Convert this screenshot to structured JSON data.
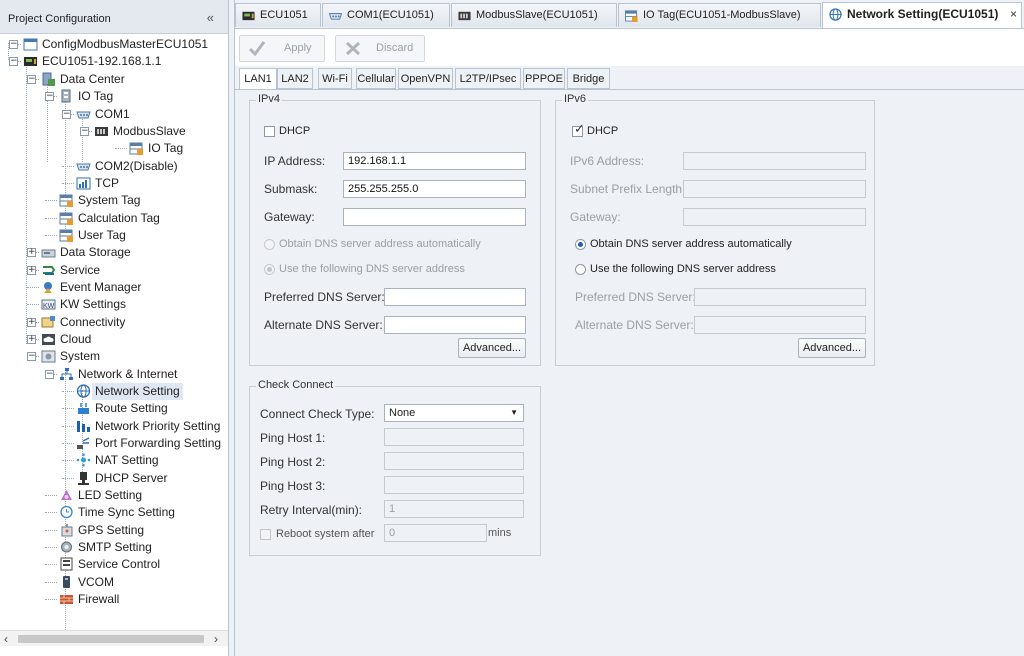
{
  "left_panel": {
    "title": "Project Configuration",
    "collapse_glyph": "«",
    "tree": [
      {
        "id": "config",
        "label": "ConfigModbusMasterECU1051",
        "icon": "window-icon",
        "exp": "−"
      },
      {
        "id": "ecu",
        "label": "ECU1051-192.168.1.1",
        "icon": "device-icon",
        "exp": "−"
      },
      {
        "id": "data-center",
        "label": "Data Center",
        "icon": "data-center-icon",
        "exp": "−"
      },
      {
        "id": "io-tag",
        "label": "IO Tag",
        "icon": "io-tag-icon",
        "exp": "−"
      },
      {
        "id": "com1",
        "label": "COM1",
        "icon": "com-port-icon",
        "exp": "−"
      },
      {
        "id": "modbus-slave",
        "label": "ModbusSlave",
        "icon": "modbus-slave-icon",
        "exp": "−"
      },
      {
        "id": "io-tag-sub",
        "label": "IO Tag",
        "icon": "tag-table-icon"
      },
      {
        "id": "com2",
        "label": "COM2(Disable)",
        "icon": "com-port-icon"
      },
      {
        "id": "tcp",
        "label": "TCP",
        "icon": "tcp-icon"
      },
      {
        "id": "system-tag",
        "label": "System Tag",
        "icon": "tag-table-icon"
      },
      {
        "id": "calculation-tag",
        "label": "Calculation Tag",
        "icon": "tag-table-icon"
      },
      {
        "id": "user-tag",
        "label": "User Tag",
        "icon": "tag-table-icon"
      },
      {
        "id": "data-storage",
        "label": "Data Storage",
        "icon": "storage-icon",
        "exp": "+"
      },
      {
        "id": "service",
        "label": "Service",
        "icon": "service-icon",
        "exp": "+"
      },
      {
        "id": "event-manager",
        "label": "Event Manager",
        "icon": "event-manager-icon"
      },
      {
        "id": "kw-settings",
        "label": "KW Settings",
        "icon": "kw-icon"
      },
      {
        "id": "connectivity",
        "label": "Connectivity",
        "icon": "connectivity-icon",
        "exp": "+"
      },
      {
        "id": "cloud",
        "label": "Cloud",
        "icon": "cloud-icon",
        "exp": "+"
      },
      {
        "id": "system",
        "label": "System",
        "icon": "system-icon",
        "exp": "−"
      },
      {
        "id": "network-internet",
        "label": "Network & Internet",
        "icon": "network-icon",
        "exp": "−"
      },
      {
        "id": "network-setting",
        "label": "Network Setting",
        "icon": "globe-icon"
      },
      {
        "id": "route-setting",
        "label": "Route Setting",
        "icon": "route-icon"
      },
      {
        "id": "network-priority",
        "label": "Network Priority Setting",
        "icon": "priority-icon"
      },
      {
        "id": "port-forwarding",
        "label": "Port Forwarding Setting",
        "icon": "port-forwarding-icon"
      },
      {
        "id": "nat-setting",
        "label": "NAT Setting",
        "icon": "nat-icon"
      },
      {
        "id": "dhcp-server",
        "label": "DHCP Server",
        "icon": "dhcp-server-icon"
      },
      {
        "id": "led-setting",
        "label": "LED Setting",
        "icon": "led-icon"
      },
      {
        "id": "time-sync",
        "label": "Time Sync Setting",
        "icon": "clock-icon"
      },
      {
        "id": "gps-setting",
        "label": "GPS Setting",
        "icon": "gps-icon"
      },
      {
        "id": "smtp-setting",
        "label": "SMTP Setting",
        "icon": "smtp-icon"
      },
      {
        "id": "service-control",
        "label": "Service Control",
        "icon": "service-control-icon"
      },
      {
        "id": "vcom",
        "label": "VCOM",
        "icon": "vcom-icon"
      },
      {
        "id": "firewall",
        "label": "Firewall",
        "icon": "firewall-icon"
      }
    ],
    "scroll_left": "‹",
    "scroll_right": "›"
  },
  "doc_tabs": [
    {
      "label": "ECU1051",
      "icon": "device-icon"
    },
    {
      "label": "COM1(ECU1051)",
      "icon": "com-port-icon"
    },
    {
      "label": "ModbusSlave(ECU1051)",
      "icon": "modbus-slave-icon"
    },
    {
      "label": "IO Tag(ECU1051-ModbusSlave)",
      "icon": "tag-table-icon"
    },
    {
      "label": "Network Setting(ECU1051)",
      "icon": "globe-icon",
      "active": true
    }
  ],
  "close_glyph": "×",
  "toolbar": {
    "apply_label": "Apply",
    "discard_label": "Discard"
  },
  "sub_tabs": [
    "LAN1",
    "LAN2",
    "Wi-Fi",
    "Cellular",
    "OpenVPN",
    "L2TP/IPsec",
    "PPPOE",
    "Bridge"
  ],
  "ipv4": {
    "title": "IPv4",
    "dhcp_label": "DHCP",
    "dhcp_checked": false,
    "ip_label": "IP Address:",
    "ip_value": "192.168.1.1",
    "submask_label": "Submask:",
    "submask_value": "255.255.255.0",
    "gateway_label": "Gateway:",
    "gateway_value": "",
    "dns_auto_label": "Obtain DNS server address automatically",
    "dns_manual_label": "Use the following DNS server address",
    "preferred_dns_label": "Preferred DNS Server:",
    "preferred_dns_value": "",
    "alternate_dns_label": "Alternate DNS Server:",
    "alternate_dns_value": "",
    "advanced_label": "Advanced..."
  },
  "ipv6": {
    "title": "IPv6",
    "dhcp_label": "DHCP",
    "dhcp_checked": true,
    "address_label": "IPv6 Address:",
    "address_value": "",
    "prefix_label": "Subnet Prefix Length:",
    "prefix_value": "",
    "gateway_label": "Gateway:",
    "gateway_value": "",
    "dns_auto_label": "Obtain DNS server address automatically",
    "dns_manual_label": "Use the following DNS server address",
    "preferred_dns_label": "Preferred DNS Server:",
    "preferred_dns_value": "",
    "alternate_dns_label": "Alternate DNS Server:",
    "alternate_dns_value": "",
    "advanced_label": "Advanced..."
  },
  "check_connect": {
    "title": "Check Connect",
    "type_label": "Connect Check Type:",
    "type_value": "None",
    "ping1_label": "Ping Host 1:",
    "ping1_value": "",
    "ping2_label": "Ping Host 2:",
    "ping2_value": "",
    "ping3_label": "Ping Host 3:",
    "ping3_value": "",
    "retry_label": "Retry Interval(min):",
    "retry_value": "1",
    "reboot_label": "Reboot system after",
    "reboot_value": "0",
    "reboot_unit": "mins"
  },
  "colors": {
    "accent": "#1e5fb4",
    "panel_bg": "#eef1f5",
    "border": "#b9c4d2"
  }
}
